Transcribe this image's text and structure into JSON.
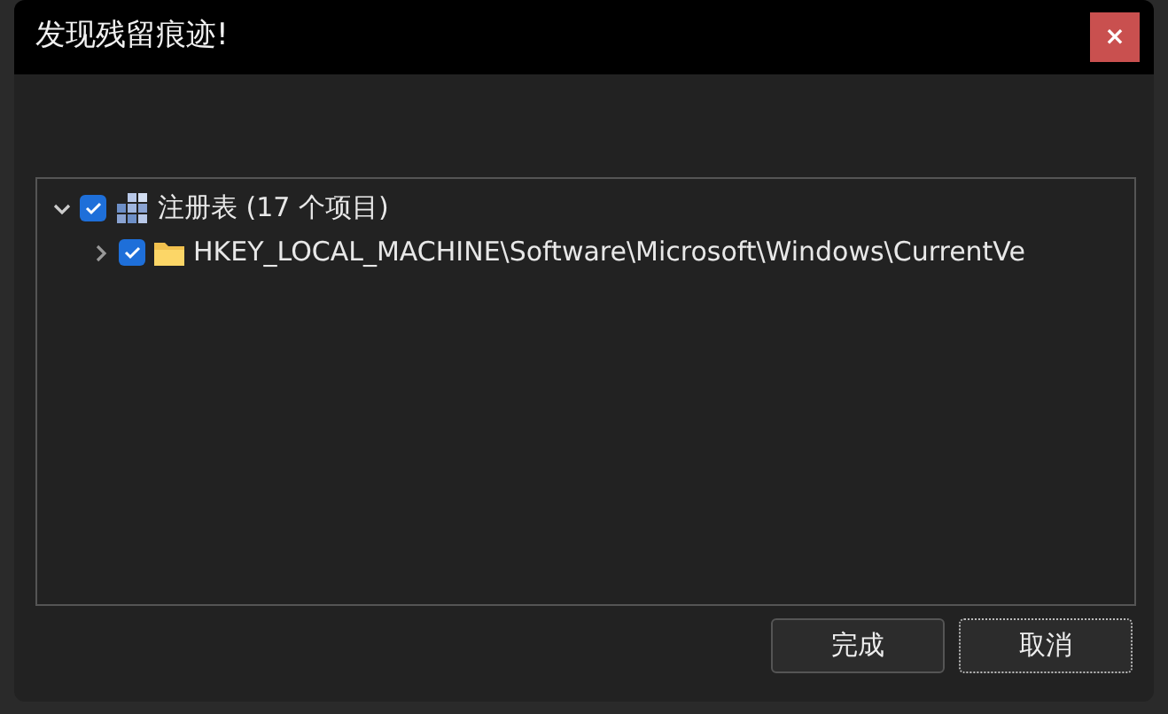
{
  "window": {
    "title": "发现残留痕迹!",
    "close": "×"
  },
  "tree": [
    {
      "label": "注册表 (17 个项目)",
      "kind": "registry",
      "checked": true,
      "expanded": true,
      "children": [
        {
          "label": "HKEY_LOCAL_MACHINE\\Software\\Microsoft\\Windows\\CurrentVe",
          "kind": "folder",
          "checked": true,
          "expanded": false
        }
      ]
    }
  ],
  "buttons": [
    {
      "label": "完成",
      "focused": false
    },
    {
      "label": "取消",
      "focused": true
    }
  ]
}
